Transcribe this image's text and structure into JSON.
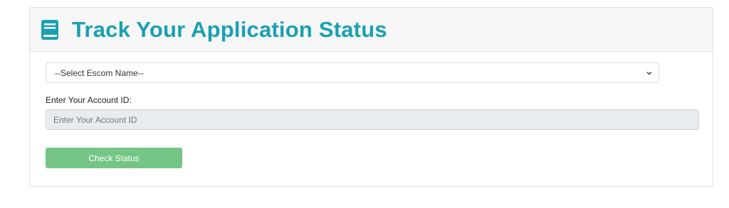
{
  "header": {
    "title": "Track Your Application Status",
    "icon": "book-icon",
    "accent_color": "#1aa0b3"
  },
  "form": {
    "escom_select": {
      "selected": "--Select Escom Name--",
      "icon": "chevron-down-icon"
    },
    "account_label": "Enter Your Account ID:",
    "account_input": {
      "value": "",
      "placeholder": "Enter Your Account ID"
    },
    "submit_label": "Check Status",
    "submit_color": "#75c686"
  }
}
